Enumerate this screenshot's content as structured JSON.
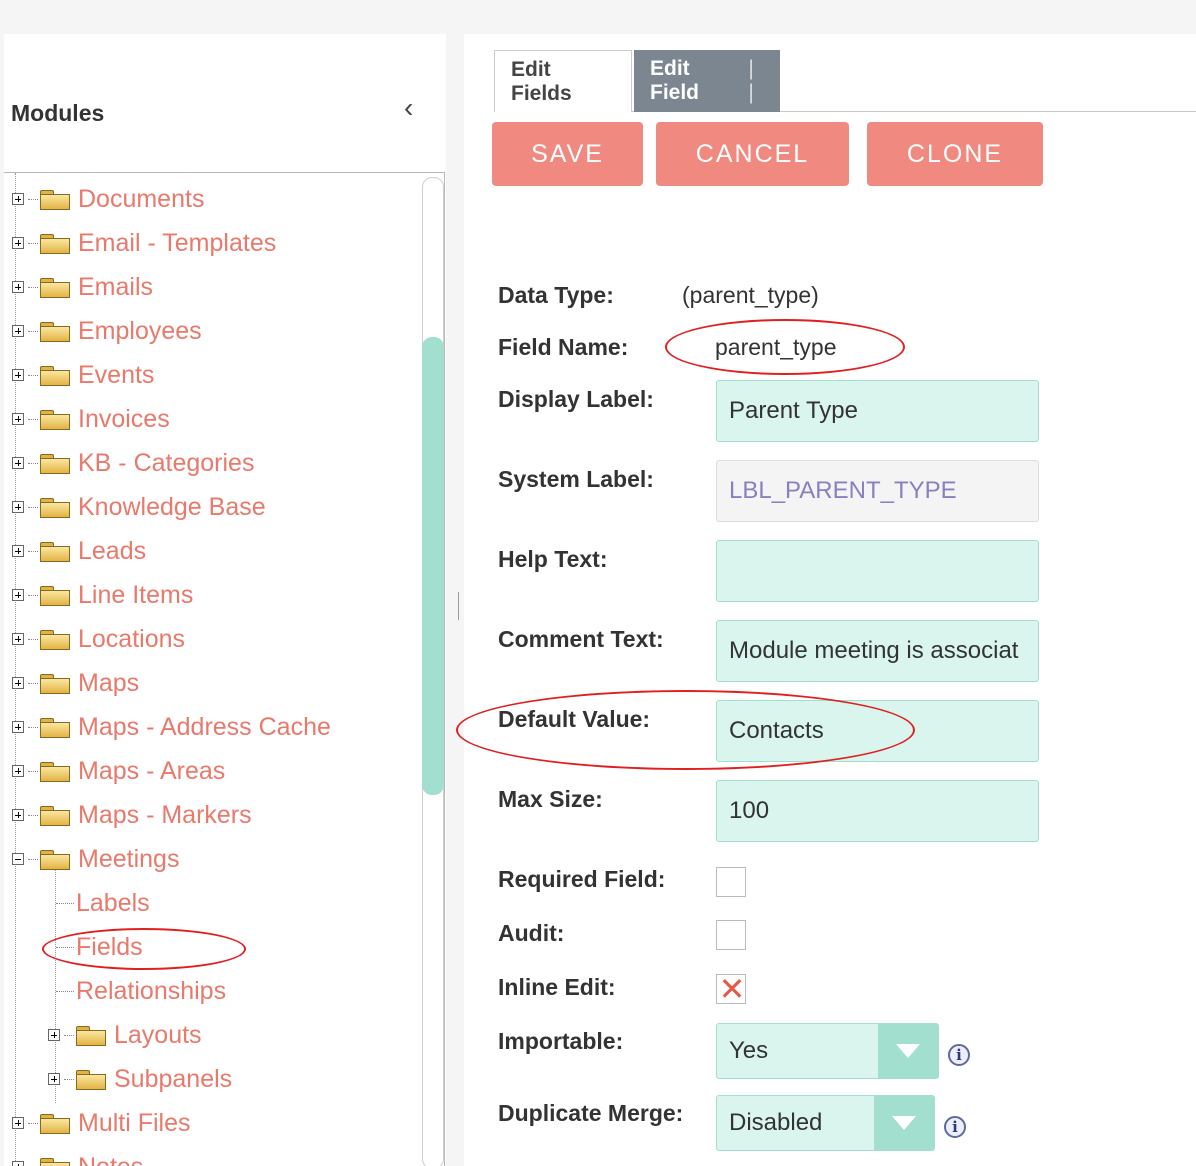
{
  "sidebar": {
    "title": "Modules",
    "collapse_icon": "chevron-left-icon",
    "tree": [
      {
        "label": "Documents"
      },
      {
        "label": "Email - Templates"
      },
      {
        "label": "Emails"
      },
      {
        "label": "Employees"
      },
      {
        "label": "Events"
      },
      {
        "label": "Invoices"
      },
      {
        "label": "KB - Categories"
      },
      {
        "label": "Knowledge Base"
      },
      {
        "label": "Leads"
      },
      {
        "label": "Line Items"
      },
      {
        "label": "Locations"
      },
      {
        "label": "Maps"
      },
      {
        "label": "Maps - Address Cache"
      },
      {
        "label": "Maps - Areas"
      },
      {
        "label": "Maps - Markers"
      },
      {
        "label": "Meetings"
      },
      {
        "label": "Labels"
      },
      {
        "label": "Fields"
      },
      {
        "label": "Relationships"
      },
      {
        "label": "Layouts"
      },
      {
        "label": "Subpanels"
      },
      {
        "label": "Multi Files"
      },
      {
        "label": "Notes"
      }
    ]
  },
  "tabs": [
    "Edit Fields",
    "Edit Field"
  ],
  "tab_separator": "|  |",
  "buttons": {
    "save": "SAVE",
    "cancel": "CANCEL",
    "clone": "CLONE"
  },
  "form": {
    "data_type_label": "Data Type:",
    "data_type_value": "(parent_type)",
    "field_name_label": "Field Name:",
    "field_name_value": "parent_type",
    "display_label_label": "Display Label:",
    "display_label_value": "Parent Type",
    "system_label_label": "System Label:",
    "system_label_value": "LBL_PARENT_TYPE",
    "help_text_label": "Help Text:",
    "help_text_value": "",
    "comment_text_label": "Comment Text:",
    "comment_text_value": "Module meeting is associat",
    "default_value_label": "Default Value:",
    "default_value_value": "Contacts",
    "max_size_label": "Max Size:",
    "max_size_value": "100",
    "required_label": "Required Field:",
    "required_checked": false,
    "audit_label": "Audit:",
    "audit_checked": false,
    "inline_edit_label": "Inline Edit:",
    "inline_edit_checked": true,
    "inline_edit_mark": "✕",
    "importable_label": "Importable:",
    "importable_value": "Yes",
    "duplicate_merge_label": "Duplicate Merge:",
    "duplicate_merge_value": "Disabled",
    "info_glyph": "i"
  },
  "colors": {
    "accent": "#f08a80",
    "link": "#e8796b",
    "input_bg": "#d9f5ed",
    "select_arrow": "#a3dfcf",
    "tab_active": "#7b8690",
    "annotation": "#e02020"
  }
}
